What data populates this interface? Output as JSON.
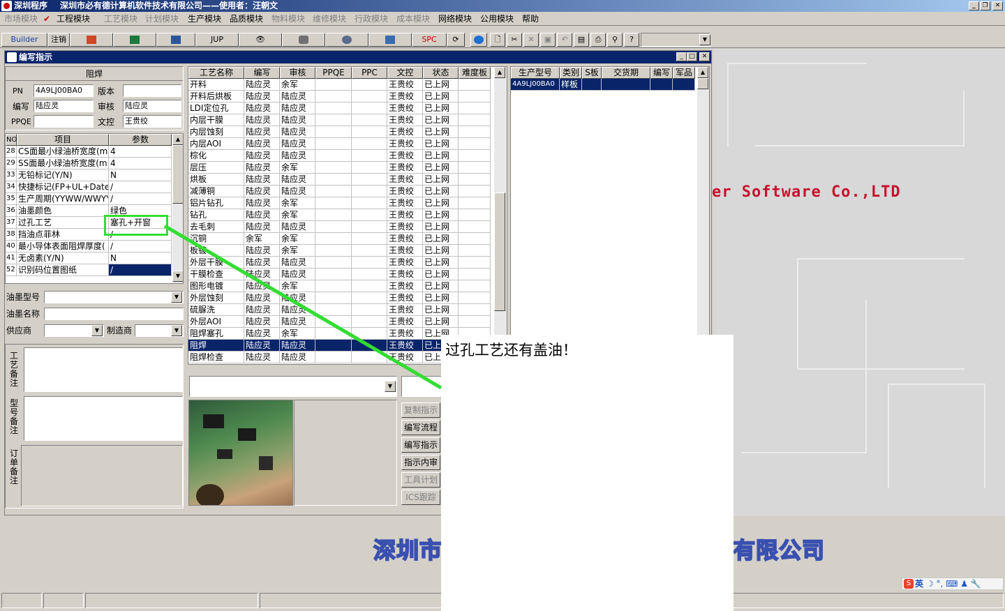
{
  "titlebar": {
    "app": "深圳程序",
    "subtitle": "深圳市必有德计算机软件技术有限公司——使用者：汪朝文"
  },
  "menu": [
    {
      "label": "市场模块",
      "disabled": true
    },
    {
      "label": "工程模块",
      "disabled": false
    },
    {
      "label": "工艺模块",
      "disabled": true
    },
    {
      "label": "计划模块",
      "disabled": true
    },
    {
      "label": "生产模块",
      "disabled": false
    },
    {
      "label": "品质模块",
      "disabled": false
    },
    {
      "label": "物料模块",
      "disabled": true
    },
    {
      "label": "维修模块",
      "disabled": true
    },
    {
      "label": "行政模块",
      "disabled": true
    },
    {
      "label": "成本模块",
      "disabled": true
    },
    {
      "label": "网络模块",
      "disabled": false
    },
    {
      "label": "公用模块",
      "disabled": false
    },
    {
      "label": "帮助",
      "disabled": false
    }
  ],
  "toolbar": {
    "builder": "Builder",
    "logout": "注销",
    "jup": "JUP",
    "spc": "SPC"
  },
  "window": {
    "title": "编写指示"
  },
  "header_panel": {
    "title": "阻焊",
    "pn_label": "PN",
    "pn_value": "4A9LJ00BA0",
    "version_label": "版本",
    "version_value": "",
    "writer_label": "编写",
    "writer_value": "陆应灵",
    "review_label": "审核",
    "review_value": "陆应灵",
    "ppqe_label": "PPQE",
    "ppqe_value": "",
    "doc_label": "文控",
    "doc_value": "王贵绞"
  },
  "param_grid": {
    "headers": [
      "NO",
      "项目",
      "参数"
    ],
    "rows": [
      [
        "28",
        "CS面最小绿油桥宽度(m",
        "4"
      ],
      [
        "29",
        "SS面最小绿油桥宽度(m",
        "4"
      ],
      [
        "33",
        "无铅标记(Y/N)",
        "N"
      ],
      [
        "34",
        "快捷标记(FP+UL+DateCo",
        "/"
      ],
      [
        "35",
        "生产周期(YYWW/WWYY)",
        "/"
      ],
      [
        "36",
        "油墨颜色",
        "绿色"
      ],
      [
        "37",
        "过孔工艺",
        "塞孔+开窗"
      ],
      [
        "38",
        "挡油点菲林",
        "/"
      ],
      [
        "40",
        "最小导体表面阻焊厚度(",
        "/"
      ],
      [
        "41",
        "无卤素(Y/N)",
        "N"
      ],
      [
        "52",
        "识别码位置图纸",
        "/"
      ]
    ]
  },
  "ink_fields": {
    "type_label": "油墨型号",
    "name_label": "油墨名称",
    "supplier_label": "供应商",
    "maker_label": "制造商"
  },
  "notes": {
    "process_label": "工艺备注",
    "model_label": "型号备注",
    "order_label": "订单备注"
  },
  "process_grid": {
    "headers": [
      "工艺名称",
      "编写",
      "审核",
      "PPQE",
      "PPC",
      "文控",
      "状态",
      "难度板"
    ],
    "rows": [
      [
        "开料",
        "陆应灵",
        "余军",
        "",
        "",
        "王贵绞",
        "已上网"
      ],
      [
        "开料后烘板",
        "陆应灵",
        "陆应灵",
        "",
        "",
        "王贵绞",
        "已上网"
      ],
      [
        "LDI定位孔",
        "陆应灵",
        "陆应灵",
        "",
        "",
        "王贵绞",
        "已上网"
      ],
      [
        "内层干膜",
        "陆应灵",
        "陆应灵",
        "",
        "",
        "王贵绞",
        "已上网"
      ],
      [
        "内层蚀刻",
        "陆应灵",
        "陆应灵",
        "",
        "",
        "王贵绞",
        "已上网"
      ],
      [
        "内层AOI",
        "陆应灵",
        "陆应灵",
        "",
        "",
        "王贵绞",
        "已上网"
      ],
      [
        "棕化",
        "陆应灵",
        "陆应灵",
        "",
        "",
        "王贵绞",
        "已上网"
      ],
      [
        "层压",
        "陆应灵",
        "余军",
        "",
        "",
        "王贵绞",
        "已上网"
      ],
      [
        "烘板",
        "陆应灵",
        "陆应灵",
        "",
        "",
        "王贵绞",
        "已上网"
      ],
      [
        "减薄铜",
        "陆应灵",
        "陆应灵",
        "",
        "",
        "王贵绞",
        "已上网"
      ],
      [
        "铝片钻孔",
        "陆应灵",
        "余军",
        "",
        "",
        "王贵绞",
        "已上网"
      ],
      [
        "钻孔",
        "陆应灵",
        "余军",
        "",
        "",
        "王贵绞",
        "已上网"
      ],
      [
        "去毛刺",
        "陆应灵",
        "陆应灵",
        "",
        "",
        "王贵绞",
        "已上网"
      ],
      [
        "沉铜",
        "余军",
        "余军",
        "",
        "",
        "王贵绞",
        "已上网"
      ],
      [
        "板镀",
        "陆应灵",
        "余军",
        "",
        "",
        "王贵绞",
        "已上网"
      ],
      [
        "外层干膜",
        "陆应灵",
        "陆应灵",
        "",
        "",
        "王贵绞",
        "已上网"
      ],
      [
        "干膜检查",
        "陆应灵",
        "陆应灵",
        "",
        "",
        "王贵绞",
        "已上网"
      ],
      [
        "图形电镀",
        "陆应灵",
        "余军",
        "",
        "",
        "王贵绞",
        "已上网"
      ],
      [
        "外层蚀刻",
        "陆应灵",
        "陆应灵",
        "",
        "",
        "王贵绞",
        "已上网"
      ],
      [
        "硫脲洗",
        "陆应灵",
        "陆应灵",
        "",
        "",
        "王贵绞",
        "已上网"
      ],
      [
        "外层AOI",
        "陆应灵",
        "陆应灵",
        "",
        "",
        "王贵绞",
        "已上网"
      ],
      [
        "阻焊塞孔",
        "陆应灵",
        "余军",
        "",
        "",
        "王贵绞",
        "已上网"
      ],
      [
        "阻焊",
        "陆应灵",
        "陆应灵",
        "",
        "",
        "王贵绞",
        "已上"
      ],
      [
        "阻焊检查",
        "陆应灵",
        "陆应灵",
        "",
        "",
        "王贵绞",
        "已上网"
      ]
    ]
  },
  "order_grid": {
    "headers": [
      "生产型号",
      "类别",
      "S板",
      "交货期",
      "编写",
      "军品"
    ],
    "rows": [
      [
        "4A9LJ00BA0",
        "样板",
        "",
        "",
        "",
        ""
      ]
    ]
  },
  "side_buttons": [
    {
      "label": "复制指示",
      "disabled": true
    },
    {
      "label": "编写流程",
      "disabled": false
    },
    {
      "label": "编写指示",
      "disabled": false
    },
    {
      "label": "指示内审",
      "disabled": false
    },
    {
      "label": "工具计划",
      "disabled": true
    },
    {
      "label": "ICS跟踪",
      "disabled": true
    }
  ],
  "wallpaper": {
    "brand": "er Software Co.,LTD",
    "cn_left": "深圳市",
    "cn_right": "有限公司"
  },
  "annotation": {
    "comment": "过孔工艺还有盖油！",
    "highlight_color": "#33dd33"
  },
  "ime": {
    "label": "英"
  }
}
